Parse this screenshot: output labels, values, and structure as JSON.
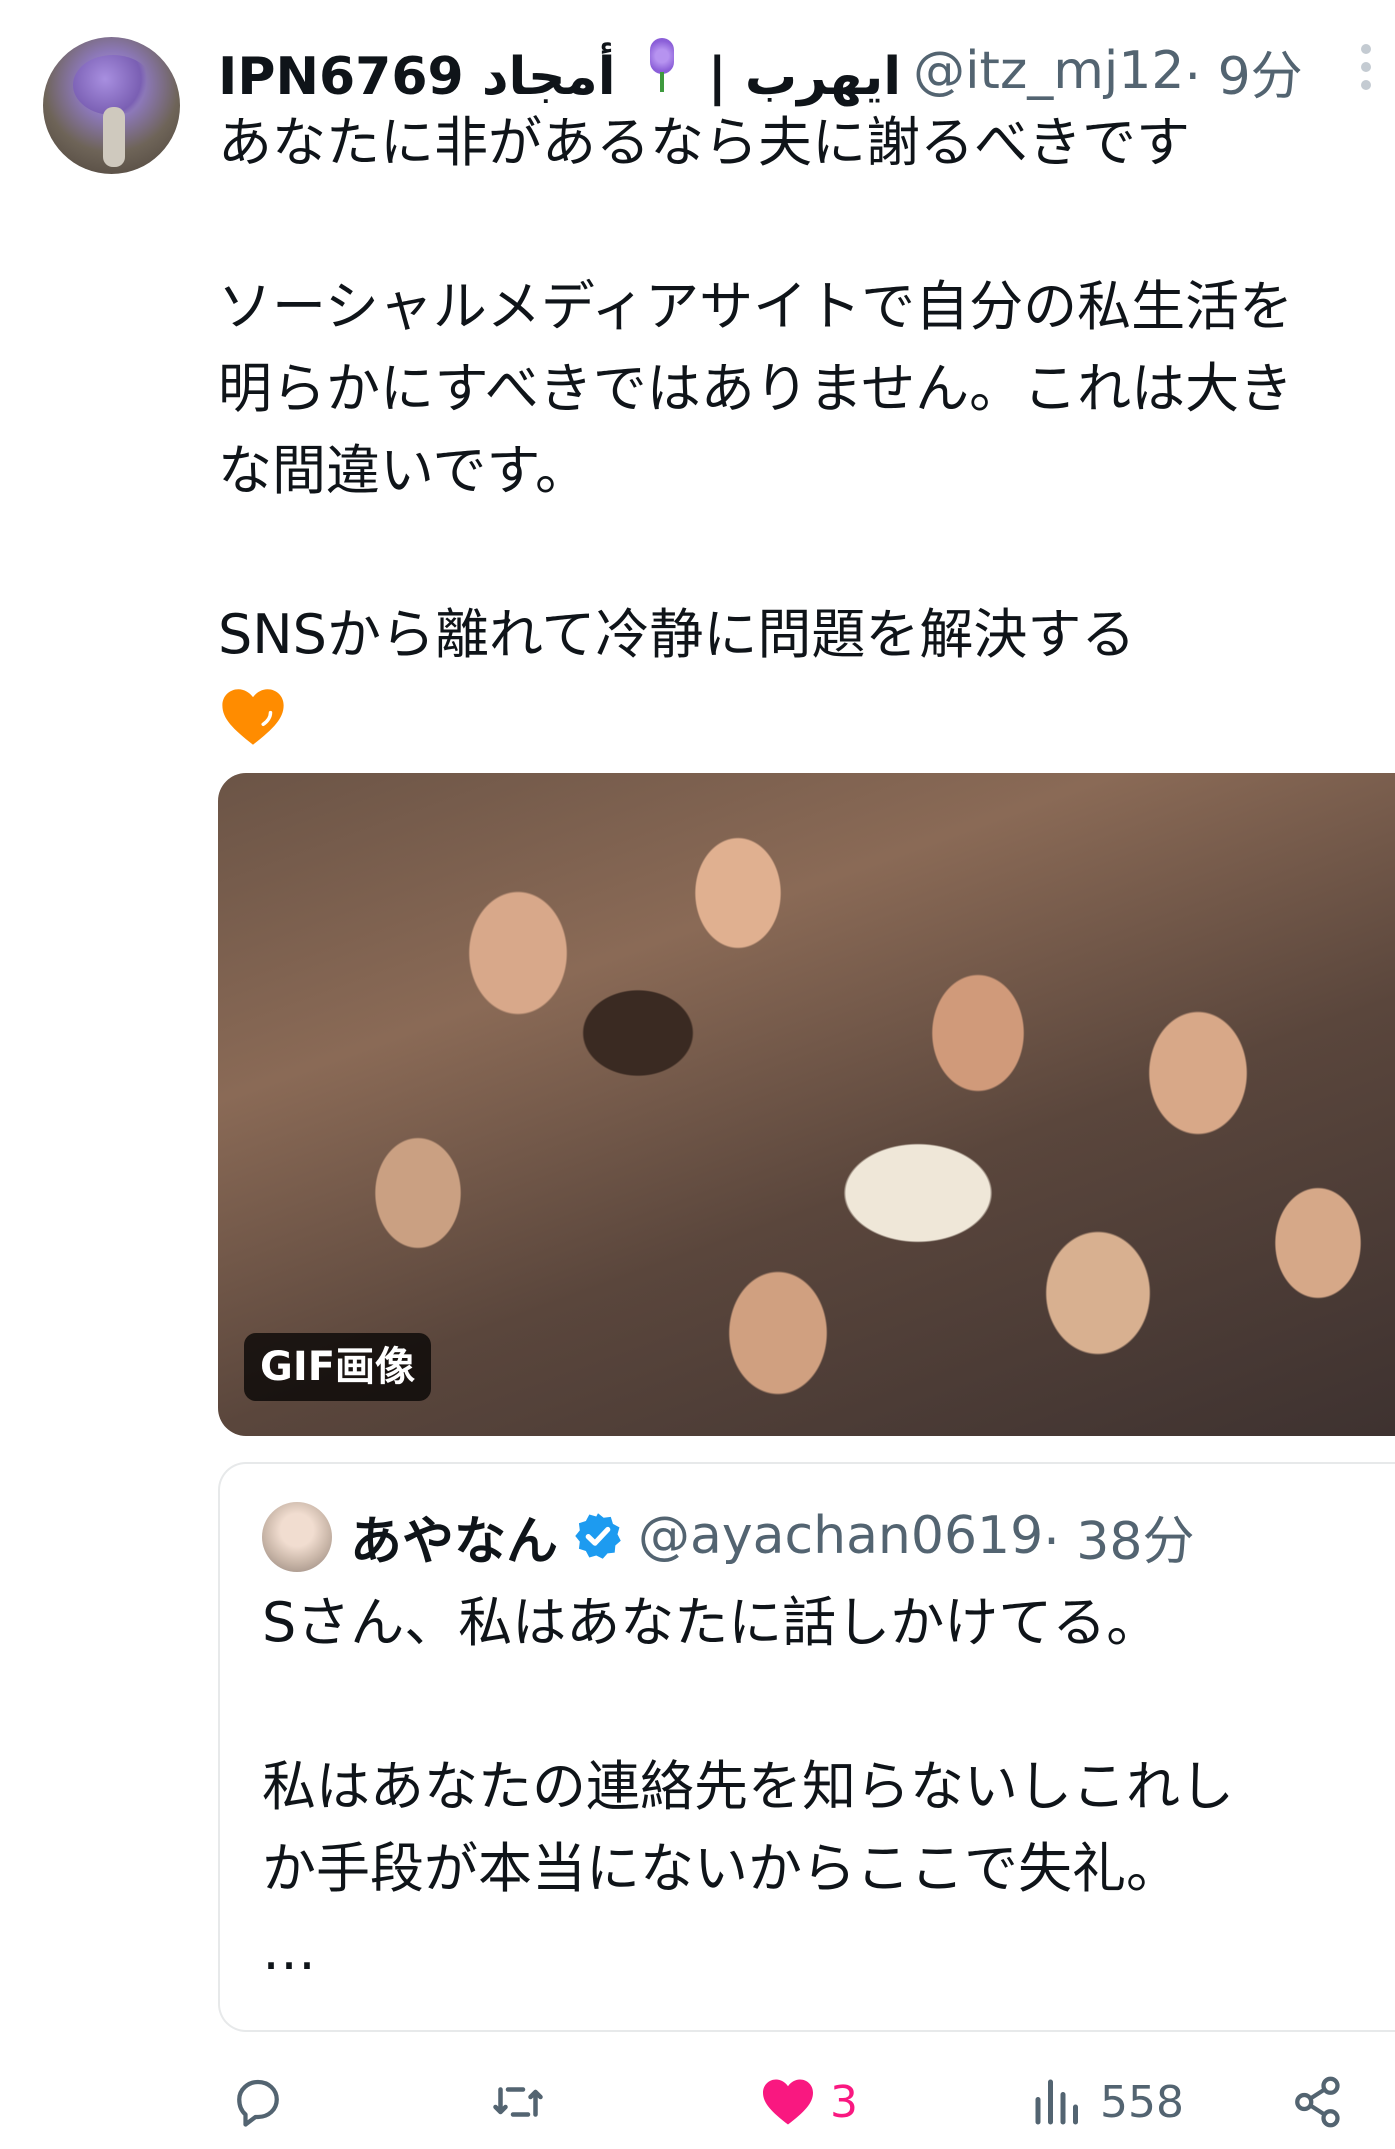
{
  "tweet": {
    "author": {
      "display_name_prefix": "IPN6769 ايهرب | ",
      "display_name_suffix": " أمجاد",
      "handle": "@itz_mj12",
      "time": " · 9分"
    },
    "lines": [
      "あなたに非があるなら夫に謝るべきです",
      "",
      "ソーシャルメディアサイトで自分の私生活を",
      "明らかにすべきではありません。これは大き",
      "な間違いです。",
      "",
      "SNSから離れて冷静に問題を解決する"
    ],
    "emoji": "orange-heart",
    "media": {
      "badge": "GIF画像"
    }
  },
  "quote": {
    "name": "あやなん",
    "handle": "@ayachan0619",
    "time": " · 38分",
    "lines": [
      "Sさん、私はあなたに話しかけてる。",
      "",
      "私はあなたの連絡先を知らないしこれし",
      "か手段が本当にないからここで失礼。",
      "…"
    ]
  },
  "actions": {
    "reply_count": "",
    "retweet_count": "",
    "like_count": "3",
    "view_count": "558"
  },
  "colors": {
    "text": "#0f1419",
    "secondary": "#536471",
    "like": "#f91880",
    "verified": "#1d9bf0",
    "heart_emoji": "#ff8c00"
  }
}
